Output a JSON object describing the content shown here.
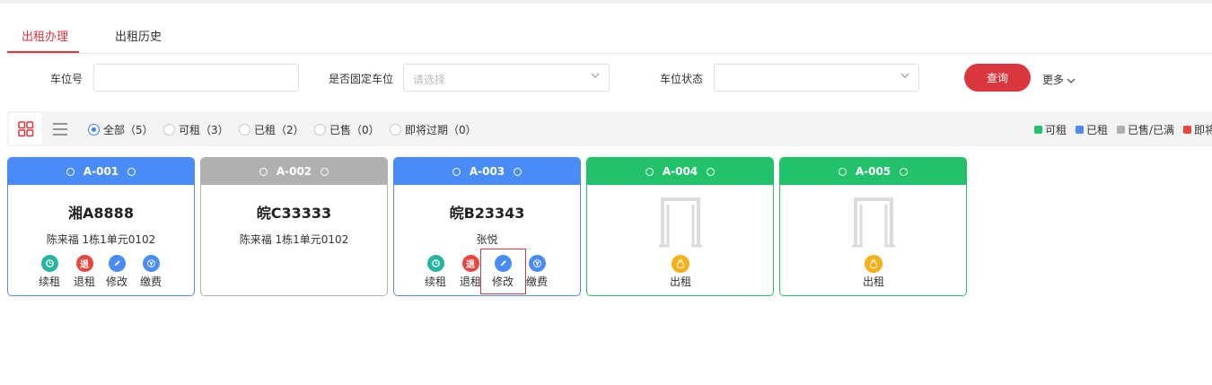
{
  "tabs": [
    {
      "label": "出租办理",
      "active": true
    },
    {
      "label": "出租历史",
      "active": false
    }
  ],
  "filters": {
    "slot_no_label": "车位号",
    "slot_no_value": "",
    "fixed_label": "是否固定车位",
    "fixed_placeholder": "请选择",
    "status_label": "车位状态",
    "status_value": "",
    "search_label": "查询",
    "more_label": "更多"
  },
  "status_filters": [
    {
      "label": "全部（5）",
      "checked": true
    },
    {
      "label": "可租（3）",
      "checked": false
    },
    {
      "label": "已租（2）",
      "checked": false
    },
    {
      "label": "已售（0）",
      "checked": false
    },
    {
      "label": "即将过期（0）",
      "checked": false
    }
  ],
  "legend": [
    {
      "label": "可租",
      "color": "#22c26b"
    },
    {
      "label": "已租",
      "color": "#4a8cf7"
    },
    {
      "label": "已售/已满",
      "color": "#b0b0b0"
    },
    {
      "label": "即将",
      "color": "#e8463d"
    }
  ],
  "colors": {
    "accent": "#d9363e",
    "blue": "#4a8cf7",
    "green": "#22c26b",
    "gray": "#b0b0b0"
  },
  "cards": [
    {
      "code": "A-001",
      "status": "rented",
      "plate": "湘A8888",
      "owner": "陈来福  1栋1单元0102",
      "actions": [
        {
          "label": "续租",
          "icon": "renew-icon"
        },
        {
          "label": "退租",
          "icon": "return-icon"
        },
        {
          "label": "修改",
          "icon": "edit-icon"
        },
        {
          "label": "缴费",
          "icon": "yen-icon"
        }
      ]
    },
    {
      "code": "A-002",
      "status": "sold",
      "plate": "皖C33333",
      "owner": "陈来福  1栋1单元0102",
      "actions": []
    },
    {
      "code": "A-003",
      "status": "rented",
      "plate": "皖B23343",
      "owner": "张悦",
      "actions": [
        {
          "label": "续租",
          "icon": "renew-icon"
        },
        {
          "label": "退租",
          "icon": "return-icon"
        },
        {
          "label": "修改",
          "icon": "edit-icon"
        },
        {
          "label": "缴费",
          "icon": "yen-icon"
        }
      ]
    },
    {
      "code": "A-004",
      "status": "available",
      "rent_label": "出租"
    },
    {
      "code": "A-005",
      "status": "available",
      "rent_label": "出租"
    }
  ],
  "action_glyphs": {
    "return": "退"
  }
}
